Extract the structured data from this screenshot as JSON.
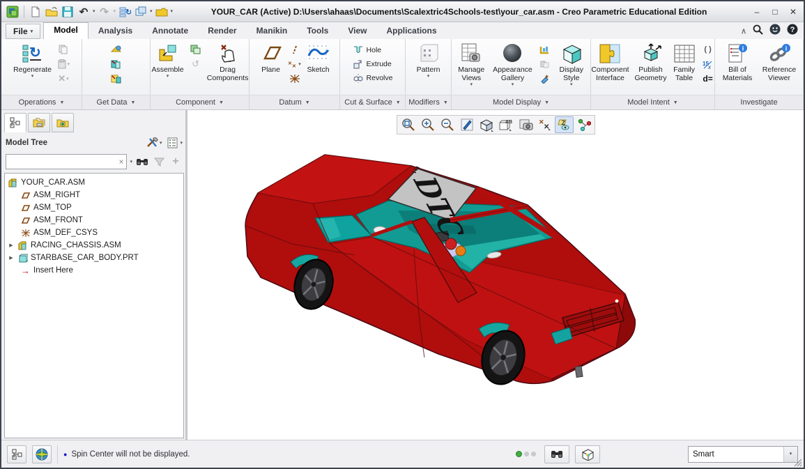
{
  "glyphs": {
    "dd": "▾",
    "ddl": "▼",
    "min": "–",
    "max": "□",
    "close": "✕",
    "clear": "×",
    "plus": "+",
    "chevup": "∧",
    "help": "?",
    "undo": "↶",
    "redo": "↷",
    "regen": "↻",
    "expander": "▶",
    "bullet": "●",
    "insert_arrow": "→",
    "xmark": "✕"
  },
  "title_bar": {
    "title": "YOUR_CAR (Active) D:\\Users\\ahaas\\Documents\\Scalextric4Schools-test\\your_car.asm - Creo Parametric Educational Edition"
  },
  "menu": {
    "file": "File",
    "tabs": [
      {
        "label": "Model"
      },
      {
        "label": "Analysis"
      },
      {
        "label": "Annotate"
      },
      {
        "label": "Render"
      },
      {
        "label": "Manikin"
      },
      {
        "label": "Tools"
      },
      {
        "label": "View"
      },
      {
        "label": "Applications"
      }
    ]
  },
  "ribbon": {
    "regenerate": "Regenerate",
    "assemble": "Assemble",
    "drag_components": "Drag Components",
    "plane": "Plane",
    "sketch": "Sketch",
    "hole": "Hole",
    "extrude": "Extrude",
    "revolve": "Revolve",
    "pattern": "Pattern",
    "manage_views": "Manage Views",
    "appearance_gallery": "Appearance Gallery",
    "display_style": "Display Style",
    "component_interface": "Component Interface",
    "publish_geometry": "Publish Geometry",
    "family_table": "Family Table",
    "parens": "( )",
    "d_equals": "d=",
    "bill_of_materials": "Bill of Materials",
    "reference_viewer": "Reference Viewer",
    "groups": {
      "operations": "Operations",
      "get_data": "Get Data",
      "component": "Component",
      "datum": "Datum",
      "cut_surface": "Cut & Surface",
      "modifiers": "Modifiers",
      "model_display": "Model Display",
      "model_intent": "Model Intent",
      "investigate": "Investigate"
    }
  },
  "model_tree": {
    "title": "Model Tree",
    "items": [
      {
        "label": "YOUR_CAR.ASM"
      },
      {
        "label": "ASM_RIGHT"
      },
      {
        "label": "ASM_TOP"
      },
      {
        "label": "ASM_FRONT"
      },
      {
        "label": "ASM_DEF_CSYS"
      },
      {
        "label": "RACING_CHASSIS.ASM"
      },
      {
        "label": "STARBASE_CAR_BODY.PRT"
      },
      {
        "label": "Insert Here"
      }
    ]
  },
  "viewport": {
    "roof_text": "DTC"
  },
  "status_bar": {
    "message": "Spin Center will not be displayed.",
    "selection_filter": "Smart"
  },
  "colors": {
    "body_red": "#b50d0d",
    "interior_teal": "#129b93",
    "accent_blue": "#1565c0"
  }
}
